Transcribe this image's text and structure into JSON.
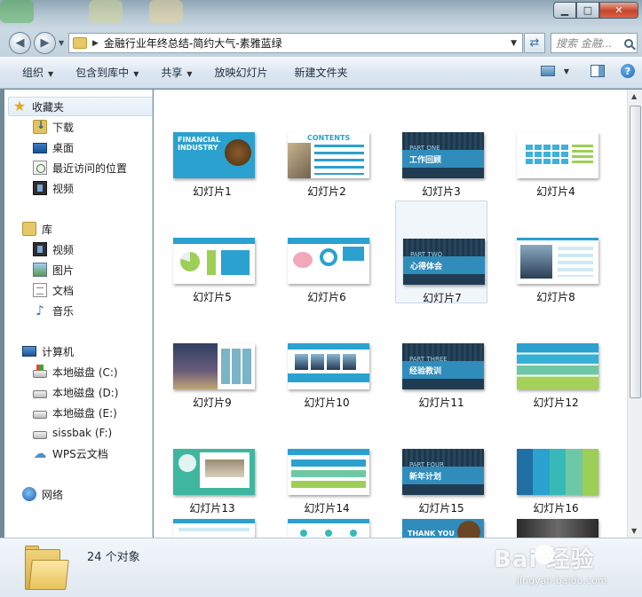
{
  "window": {
    "path": "金融行业年终总结-简约大气-素雅蓝绿",
    "search_placeholder": "搜索 金融...",
    "controls": {
      "min": "▁",
      "max": "□",
      "close": "✕"
    }
  },
  "toolbar": {
    "organize": "组织",
    "include_in_library": "包含到库中",
    "share": "共享",
    "slideshow": "放映幻灯片",
    "new_folder": "新建文件夹"
  },
  "sidebar": {
    "favorites": {
      "label": "收藏夹",
      "items": [
        "下载",
        "桌面",
        "最近访问的位置",
        "视频"
      ]
    },
    "libraries": {
      "label": "库",
      "items": [
        "视频",
        "图片",
        "文档",
        "音乐"
      ]
    },
    "computer": {
      "label": "计算机",
      "items": [
        "本地磁盘 (C:)",
        "本地磁盘 (D:)",
        "本地磁盘 (E:)",
        "sissbak (F:)",
        "WPS云文档"
      ]
    },
    "network": {
      "label": "网络"
    }
  },
  "files": [
    {
      "name": "幻灯片1",
      "theme": "light",
      "title": "FINANCIAL INDUSTRY"
    },
    {
      "name": "幻灯片2",
      "theme": "light",
      "title": "CONTENTS"
    },
    {
      "name": "幻灯片3",
      "theme": "dark",
      "part": "PART ONE",
      "subtitle": "工作回顾"
    },
    {
      "name": "幻灯片4",
      "theme": "light"
    },
    {
      "name": "幻灯片5",
      "theme": "light"
    },
    {
      "name": "幻灯片6",
      "theme": "light"
    },
    {
      "name": "幻灯片7",
      "theme": "dark",
      "part": "PART TWO",
      "subtitle": "心得体会",
      "selected": true
    },
    {
      "name": "幻灯片8",
      "theme": "light"
    },
    {
      "name": "幻灯片9",
      "theme": "photo"
    },
    {
      "name": "幻灯片10",
      "theme": "light"
    },
    {
      "name": "幻灯片11",
      "theme": "dark",
      "part": "PART THREE",
      "subtitle": "经验教训"
    },
    {
      "name": "幻灯片12",
      "theme": "bars"
    },
    {
      "name": "幻灯片13",
      "theme": "green"
    },
    {
      "name": "幻灯片14",
      "theme": "light"
    },
    {
      "name": "幻灯片15",
      "theme": "dark",
      "part": "PART FOUR",
      "subtitle": "新年计划"
    },
    {
      "name": "幻灯片16",
      "theme": "cols"
    }
  ],
  "partial_row": {
    "thank_you": "THANK YOU"
  },
  "details": {
    "count": "24 个对象"
  },
  "watermark": {
    "brand": "Bai  经验",
    "url": "jingyan.baidu.com"
  },
  "colors": {
    "accent": "#2aa1cf",
    "dark": "#203c52",
    "green": "#9dcf56"
  }
}
